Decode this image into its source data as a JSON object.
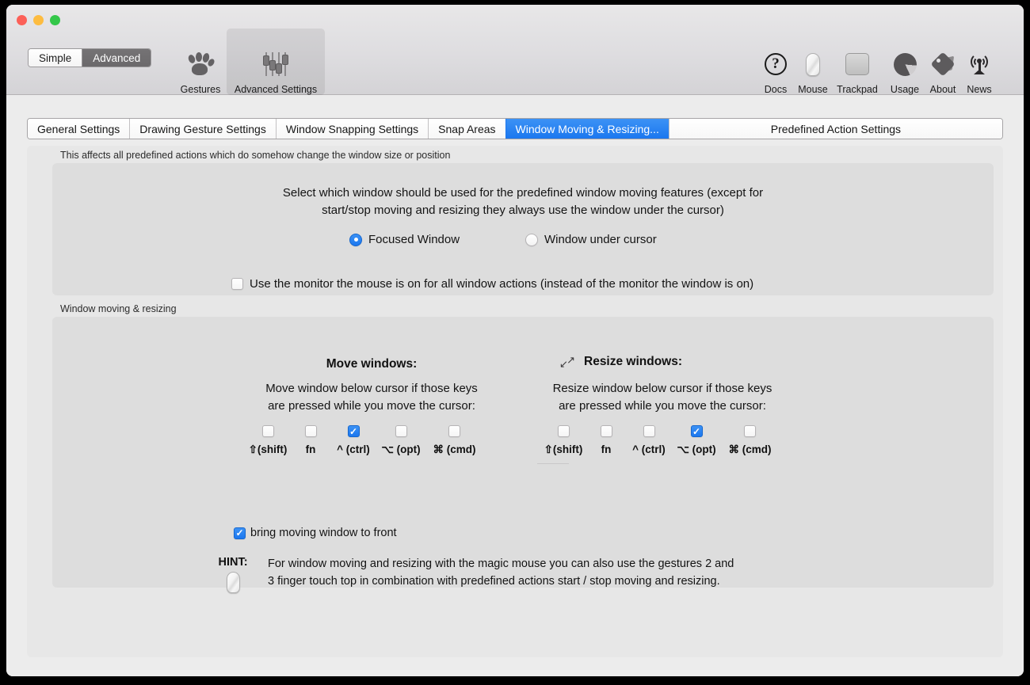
{
  "window": {
    "traffic_lights": [
      "close",
      "minimize",
      "zoom"
    ]
  },
  "toolbar": {
    "mode_segments": [
      {
        "label": "Simple",
        "active": false
      },
      {
        "label": "Advanced",
        "active": true
      }
    ],
    "left_items": [
      {
        "label": "Gestures",
        "icon": "paw-icon",
        "selected": false
      },
      {
        "label": "Advanced Settings",
        "icon": "faders-icon",
        "selected": true
      }
    ],
    "right_items": [
      {
        "label": "Docs",
        "icon": "question-mark-circle-icon"
      },
      {
        "label": "Mouse",
        "icon": "magic-mouse-icon"
      },
      {
        "label": "Trackpad",
        "icon": "trackpad-icon"
      },
      {
        "label": "Usage",
        "icon": "pie-chart-icon"
      },
      {
        "label": "About",
        "icon": "tag-icon"
      },
      {
        "label": "News",
        "icon": "broadcast-antenna-icon"
      }
    ]
  },
  "tabs": [
    {
      "label": "General Settings",
      "active": false
    },
    {
      "label": "Drawing Gesture Settings",
      "active": false
    },
    {
      "label": "Window Snapping Settings",
      "active": false
    },
    {
      "label": "Snap Areas",
      "active": false
    },
    {
      "label": "Window Moving & Resizing...",
      "active": true
    },
    {
      "label": "Predefined Action Settings",
      "active": false
    }
  ],
  "section_one": {
    "group_label": "This affects all predefined actions which do somehow change the window size or position",
    "description_line1": "Select which window should be used for the predefined window moving features (except for",
    "description_line2": "start/stop moving and resizing they always use the window under the cursor)",
    "radios": [
      {
        "label": "Focused Window",
        "checked": true
      },
      {
        "label": "Window under cursor",
        "checked": false
      }
    ],
    "monitor_checkbox": {
      "label": "Use the monitor the mouse is on for all window actions (instead of the monitor the window is on)",
      "checked": false
    }
  },
  "section_two": {
    "group_label": "Window moving & resizing",
    "move": {
      "title": "Move windows:",
      "desc_line1": "Move window below cursor if those keys",
      "desc_line2": "are pressed while you move the cursor:",
      "modifiers": [
        {
          "label": "⇧(shift)",
          "checked": false
        },
        {
          "label": "fn",
          "checked": false
        },
        {
          "label": "^ (ctrl)",
          "checked": true
        },
        {
          "label": "⌥ (opt)",
          "checked": false
        },
        {
          "label": "⌘ (cmd)",
          "checked": false
        }
      ]
    },
    "resize": {
      "icon": "resize-diagonal-arrows-icon",
      "title": "Resize windows:",
      "desc_line1": "Resize window below cursor if those keys",
      "desc_line2": "are pressed while you move the cursor:",
      "modifiers": [
        {
          "label": "⇧(shift)",
          "checked": false
        },
        {
          "label": "fn",
          "checked": false
        },
        {
          "label": "^ (ctrl)",
          "checked": false
        },
        {
          "label": "⌥ (opt)",
          "checked": true
        },
        {
          "label": "⌘ (cmd)",
          "checked": false
        }
      ]
    },
    "bring_front_checkbox": {
      "label": "bring moving window to front",
      "checked": true
    },
    "hint": {
      "label": "HINT:",
      "icon": "magic-mouse-icon",
      "line1": "For window moving and resizing with the magic mouse you can also use the gestures 2 and",
      "line2": "3 finger touch top in combination with predefined actions start / stop moving and resizing."
    }
  },
  "colors": {
    "accent_blue": "#1b77ef",
    "window_bg": "#ececec",
    "panel_bg": "#e7e7e7",
    "group_bg": "#dddddd"
  }
}
